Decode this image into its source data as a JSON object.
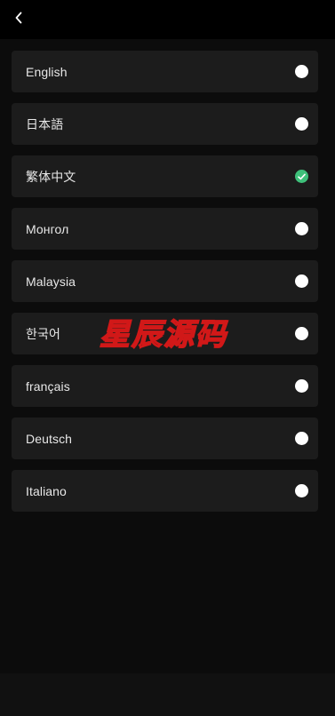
{
  "header": {
    "back_icon": "chevron-left-icon"
  },
  "languages": [
    {
      "label": "English",
      "selected": false
    },
    {
      "label": "日本語",
      "selected": false
    },
    {
      "label": "繁体中文",
      "selected": true
    },
    {
      "label": "Монгол",
      "selected": false
    },
    {
      "label": "Malaysia",
      "selected": false
    },
    {
      "label": "한국어",
      "selected": false
    },
    {
      "label": "français",
      "selected": false
    },
    {
      "label": "Deutsch",
      "selected": false
    },
    {
      "label": "Italiano",
      "selected": false
    }
  ],
  "watermark": {
    "text": "星辰源码"
  },
  "colors": {
    "background": "#0c0c0c",
    "row": "#1c1c1c",
    "selected_check": "#3ec07a",
    "radio_unselected": "#ffffff",
    "watermark": "#d11818"
  }
}
